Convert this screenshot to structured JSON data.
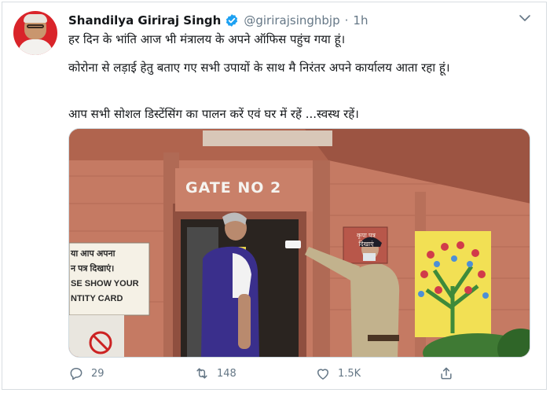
{
  "tweet": {
    "author_name": "Shandilya Giriraj Singh",
    "handle": "@girirajsinghbjp",
    "separator": "·",
    "time": "1h",
    "text_line1": "हर दिन के भांति आज भी मंत्रालय के अपने ऑफिस पहुंच गया हूं।",
    "text_line2": "कोरोना से लड़ाई हेतु बताए गए सभी उपायों के साथ मै निरंतर अपने कार्यालय आता रहा हूं।",
    "text_line3": "आप सभी सोशल डिस्टेंसिंग का पालन करें एवं घर में रहें ...स्वस्थ रहें।"
  },
  "photo": {
    "gate_sign": "GATE NO 2",
    "left_sign": [
      "या आप अपना",
      "न पत्र दिखाएं।",
      "SE SHOW YOUR",
      "NTITY CARD"
    ],
    "brown_board": [
      "कृपा पत्र",
      "दिखाएं"
    ]
  },
  "actions": {
    "reply_count": "29",
    "retweet_count": "148",
    "like_count": "1.5K"
  },
  "colors": {
    "accent": "#1da1f2",
    "muted_text": "#657786",
    "avatar_bg": "#d9242a",
    "building": "#c87660"
  },
  "icons": [
    "verified-badge-icon",
    "chevron-down-icon",
    "reply-icon",
    "retweet-icon",
    "like-icon",
    "share-icon"
  ]
}
